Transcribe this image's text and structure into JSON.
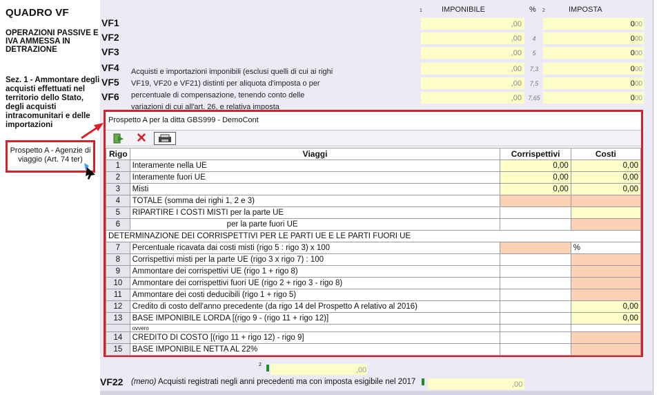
{
  "form": {
    "title": "QUADRO VF",
    "subtitle": "OPERAZIONI PASSIVE E IVA AMMESSA IN DETRAZIONE",
    "section": "Sez. 1 - Ammontare degli acquisti effettuati nel territorio dello Stato, degli acquisti intracomunitari e delle importazioni",
    "link_label": "Prospetto A - Agenzie di viaggio (Art. 74 ter)",
    "col_imponibile": "IMPONIBILE",
    "col_pct": "%",
    "col_imposta": "IMPOSTA",
    "col_num_1": "1",
    "col_num_2": "2",
    "description": "Acquisti e importazioni imponibili (esclusi quelli di cui ai righi VF19, VF20 e VF21) distinti per aliquota d'imposta o per percentuale di compensazione, tenendo conto delle variazioni di cui all'art. 26, e relativa imposta",
    "rows": [
      {
        "code": "VF1",
        "imp_dec": ",00",
        "pct": "",
        "iva": "0",
        "iva_dec": "00"
      },
      {
        "code": "VF2",
        "imp_dec": ",00",
        "pct": "4",
        "iva": "0",
        "iva_dec": "00"
      },
      {
        "code": "VF3",
        "imp_dec": ",00",
        "pct": "5",
        "iva": "0",
        "iva_dec": "00"
      },
      {
        "code": "VF4",
        "imp_dec": ",00",
        "pct": "7,3",
        "iva": "0",
        "iva_dec": "00"
      },
      {
        "code": "VF5",
        "imp_dec": ",00",
        "pct": "7,5",
        "iva": "0",
        "iva_dec": "00"
      },
      {
        "code": "VF6",
        "imp_dec": ",00",
        "pct": "7,65",
        "iva": "0",
        "iva_dec": "00"
      }
    ],
    "row2_num": "2",
    "row2_dec": ",00",
    "vf22_code": "VF22",
    "vf22_meno": "(meno)",
    "vf22_desc": "Acquisti registrati negli anni precedenti ma con imposta esigibile nel 2017",
    "vf22_dec": ",00"
  },
  "popup": {
    "title": "Prospetto A per la ditta GBS999 -  DemoCont",
    "toolbar": {
      "confirm_icon": "confirm-icon",
      "close_icon": "close-icon",
      "print_icon": "print-icon"
    },
    "headers": {
      "rigo": "Rigo",
      "viaggi": "Viaggi",
      "corrispettivi": "Corrispettivi",
      "costi": "Costi"
    },
    "section_label": "DETERMINAZIONE DEI CORRISPETTIVI PER LE PARTI UE E LE PARTI FUORI UE",
    "ovvero": "ovvero",
    "pct_sign": "%",
    "rows": [
      {
        "num": "1",
        "label": "Interamente nella UE",
        "corr": "0,00",
        "costi": "0,00"
      },
      {
        "num": "2",
        "label": "Interamente fuori UE",
        "corr": "0,00",
        "costi": "0,00"
      },
      {
        "num": "3",
        "label": "Misti",
        "corr": "0,00",
        "costi": "0,00"
      },
      {
        "num": "4",
        "label": "TOTALE (somma dei righi 1, 2 e 3)",
        "corr": "",
        "costi": ""
      },
      {
        "num": "5",
        "label": "RIPARTIRE I COSTI MISTI per la parte UE",
        "corr": "",
        "costi": ""
      },
      {
        "num": "6",
        "label": "per la parte fuori UE",
        "corr": "",
        "costi": ""
      },
      {
        "num": "7",
        "label": "Percentuale ricavata dai costi misti (rigo 5 : rigo 3) x 100",
        "corr": "",
        "costi": ""
      },
      {
        "num": "8",
        "label": "Corrispettivi misti per la parte UE (rigo 3 x rigo 7) : 100",
        "corr": "",
        "costi": ""
      },
      {
        "num": "9",
        "label": "Ammontare dei corrispettivi UE (rigo 1 + rigo 8)",
        "corr": "",
        "costi": ""
      },
      {
        "num": "10",
        "label": "Ammontare dei corrispettivi fuori UE (rigo 2 + rigo 3 - rigo 8)",
        "corr": "",
        "costi": ""
      },
      {
        "num": "11",
        "label": "Ammontare dei costi deducibili (rigo 1 + rigo 5)",
        "corr": "",
        "costi": ""
      },
      {
        "num": "12",
        "label": "Credito di costo dell'anno precedente (da rigo 14 del Prospetto A relativo al 2016)",
        "corr": "",
        "costi": "0,00"
      },
      {
        "num": "13",
        "label": "BASE IMPONIBILE LORDA [(rigo 9 - (rigo 11 + rigo 12)]",
        "corr": "",
        "costi": "0,00"
      },
      {
        "num": "14",
        "label": "CREDITO DI COSTO [(rigo 11 + rigo 12) - rigo 9]",
        "corr": "",
        "costi": ""
      },
      {
        "num": "15",
        "label": "BASE IMPONIBILE NETTA AL 22%",
        "corr": "",
        "costi": ""
      }
    ]
  },
  "colors": {
    "accent_red": "#d6202a",
    "input_yellow": "#fdfdc8",
    "calc_orange": "#fbd3b4",
    "panel_lilac": "#ecebf5"
  }
}
